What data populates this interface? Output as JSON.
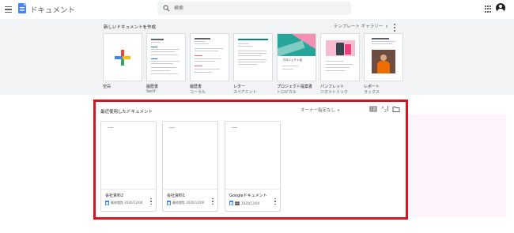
{
  "header": {
    "app_title": "ドキュメント",
    "search_placeholder": "検索"
  },
  "templates": {
    "section_title": "新しいドキュメントを作成",
    "gallery_label": "テンプレート ギャラリー",
    "items": [
      {
        "name": "空白",
        "sub": ""
      },
      {
        "name": "履歴書",
        "sub": "Serif"
      },
      {
        "name": "履歴書",
        "sub": "コーラル"
      },
      {
        "name": "レター",
        "sub": "スペアミント"
      },
      {
        "name": "プロジェクト提案書",
        "sub": "トロピカル",
        "thumb_title": "プロジェクト名"
      },
      {
        "name": "パンフレット",
        "sub": "ジオメトリック"
      },
      {
        "name": "レポート",
        "sub": "ラックス"
      }
    ]
  },
  "recent": {
    "title": "最近使用したドキュメント",
    "owner_filter": "オーナー指定なし",
    "docs": [
      {
        "name": "会社資料2",
        "date": "最終閲覧 2020/12/04"
      },
      {
        "name": "会社資料1",
        "date": "最終閲覧 2020/12/04"
      },
      {
        "name": "Googleドキュメント",
        "date": "2020/12/04"
      }
    ]
  },
  "colors": {
    "brand_blue": "#4285f4",
    "highlight_border": "#d8141e",
    "gallery_bg": "#f1f3f4"
  }
}
